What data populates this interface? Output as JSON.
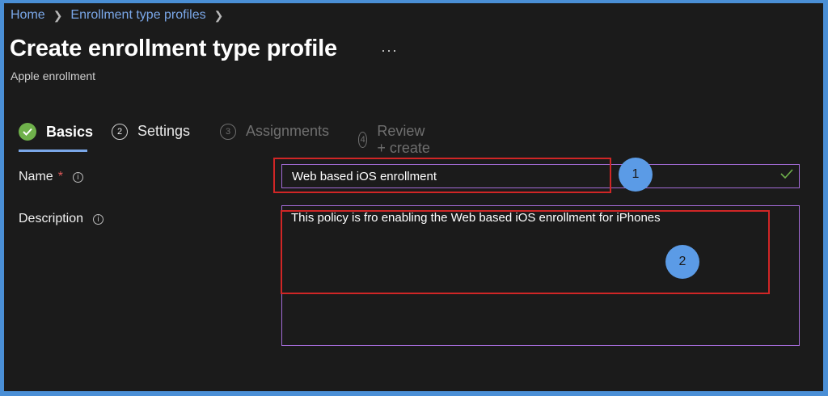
{
  "breadcrumb": {
    "home": "Home",
    "parent": "Enrollment type profiles"
  },
  "header": {
    "title": "Create enrollment type profile",
    "more": "···",
    "subtitle": "Apple enrollment"
  },
  "tabs": [
    {
      "label": "Basics",
      "state": "active"
    },
    {
      "num": "2",
      "label": "Settings",
      "state": "enabled"
    },
    {
      "num": "3",
      "label": "Assignments",
      "state": "disabled"
    },
    {
      "num": "4",
      "label": "Review + create",
      "state": "disabled"
    }
  ],
  "form": {
    "name_label": "Name",
    "required_mark": "*",
    "name_value": "Web based iOS enrollment",
    "description_label": "Description",
    "description_value": "This policy is fro enabling the Web based iOS enrollment for iPhones"
  },
  "annotations": {
    "badge1": "1",
    "badge2": "2"
  },
  "colors": {
    "accent": "#7aa7e8",
    "highlight": "#d02626",
    "input_border": "#a36bd6",
    "success": "#6fb14b"
  }
}
